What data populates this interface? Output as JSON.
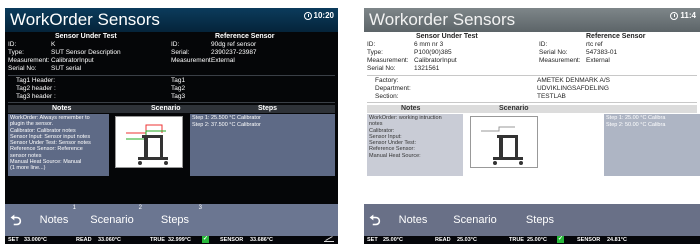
{
  "left": {
    "title": "WorkOrder Sensors",
    "clock": "10:20",
    "sut_header": "Sensor Under Test",
    "ref_header": "Reference Sensor",
    "sut": [
      {
        "k": "ID:",
        "v": "K"
      },
      {
        "k": "Type:",
        "v": "SUT Sensor Description"
      },
      {
        "k": "Measurement:",
        "v": "CalibratorInput"
      },
      {
        "k": "Serial No:",
        "v": "SUT serial"
      }
    ],
    "ref": [
      {
        "k": "ID:",
        "v": "90dg ref sensor"
      },
      {
        "k": "Serial:",
        "v": "2390237-23987"
      },
      {
        "k": "Measurement:",
        "v": "External"
      }
    ],
    "tags": [
      {
        "k": "Tag1 Header:",
        "v": "Tag1"
      },
      {
        "k": "Tag2 header :",
        "v": "Tag2"
      },
      {
        "k": "Tag3 header :",
        "v": "Tag3"
      }
    ],
    "notes_header": "Notes",
    "scenario_header": "Scenario",
    "steps_header": "Steps",
    "notes_lines": [
      "WorkOrder: Always remember to",
      "plugin the sensor.",
      "Calibrator: Calibrator notes",
      "Sensor Input: Sensor input notes",
      "Sensor Under Test: Sensor notes",
      "Reference Sensor: Reference",
      "sensor notes",
      "Manual Heat Source: Manual",
      "(1 more line...)"
    ],
    "steps": [
      "Step 1:  25.500 °C  Calibrator",
      "Step 2:  37.500 °C  Calibrator"
    ],
    "tabs": {
      "back": "⮌",
      "notes": "Notes",
      "notes_num": "1",
      "scenario": "Scenario",
      "scenario_num": "2",
      "steps": "Steps",
      "steps_num": "3"
    },
    "status": {
      "set_label": "SET",
      "set_value": "33.000°C",
      "read_label": "READ",
      "read_value": "33.060°C",
      "true_label": "TRUE",
      "true_value": "32.999°C",
      "sensor_label": "SENSOR",
      "sensor_value": "33.686°C"
    }
  },
  "right": {
    "title": "Workorder Sensors",
    "clock": "11:4",
    "sut_header": "Sensor Under Test",
    "ref_header": "Reference Sensor",
    "sut": [
      {
        "k": "ID:",
        "v": "6 mm nr 3"
      },
      {
        "k": "Type:",
        "v": "P100(90)385"
      },
      {
        "k": "Measurement:",
        "v": "CalibratorInput"
      },
      {
        "k": "Serial No:",
        "v": "1321561"
      }
    ],
    "ref": [
      {
        "k": "ID:",
        "v": "rtc ref"
      },
      {
        "k": "Serial No:",
        "v": "547383-01"
      },
      {
        "k": "Measurement:",
        "v": "External"
      }
    ],
    "tags": [
      {
        "k": "Factory:",
        "v": "AMETEK DENMARK A/S"
      },
      {
        "k": "Department:",
        "v": "UDVIKLINGSAFDELING"
      },
      {
        "k": "Section:",
        "v": "TESTLAB"
      }
    ],
    "notes_header": "Notes",
    "scenario_header": "Scenario",
    "notes_lines": [
      "WorkOrder: working intruction",
      "notes",
      "Calibrator:",
      "Sensor Input:",
      "Sensor Under Test:",
      "Reference Sensor:",
      "Manual Heat Source:"
    ],
    "steps": [
      "Step 1:  25.00 °C  Calibra",
      "Step 2:  50.00 °C  Calibra"
    ],
    "tabs": {
      "back": "⮌",
      "notes": "Notes",
      "scenario": "Scenario",
      "steps": "Steps"
    },
    "status": {
      "set_label": "SET",
      "set_value": "25.00°C",
      "read_label": "READ",
      "read_value": "25.03°C",
      "true_label": "TRUE",
      "true_value": "25.00°C",
      "sensor_label": "SENSOR",
      "sensor_value": "24.81°C"
    }
  },
  "colors": {
    "left_title_bg": "#0b3b5c",
    "right_title_bg": "#7e8689",
    "tab_bar": "#6b7691",
    "notes_bg": "#5e6a86",
    "check_green": "#27b83a"
  }
}
